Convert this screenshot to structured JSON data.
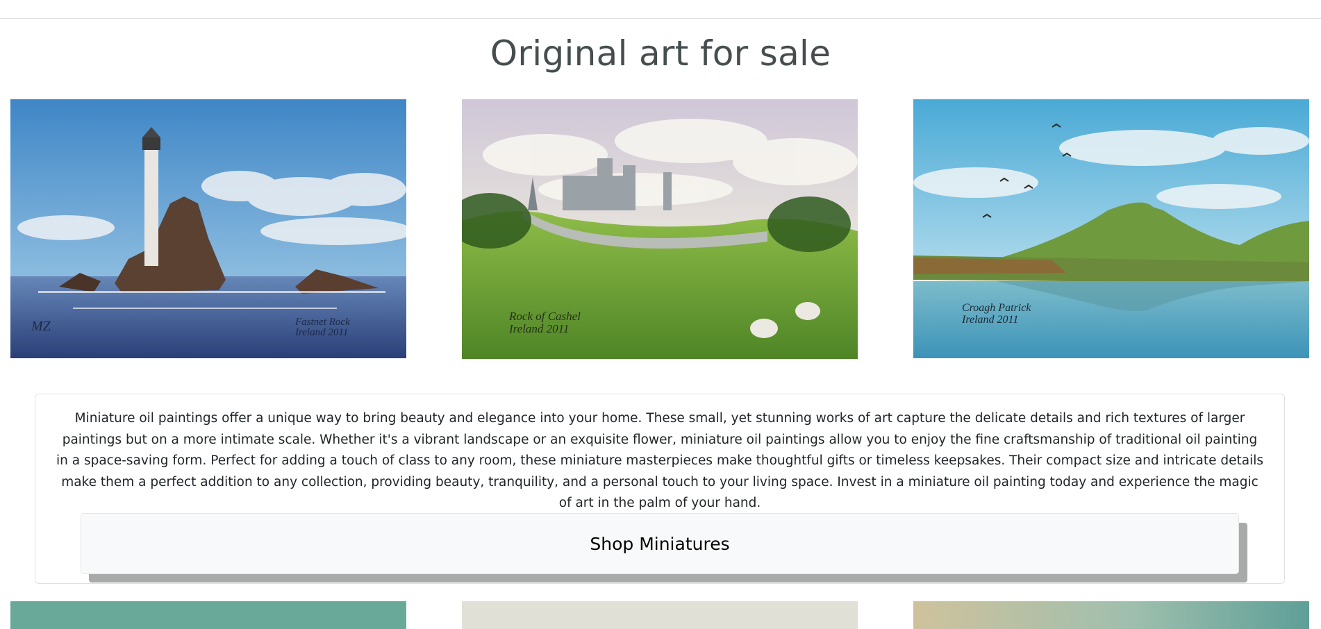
{
  "page": {
    "title": "Original art for sale"
  },
  "gallery": {
    "paintings": [
      {
        "subject": "Fastnet Rock lighthouse",
        "inscription_line1": "Fastnet Rock",
        "inscription_line2": "Ireland 2011",
        "monogram": "MZ",
        "sky": "#4f8fc8",
        "sea": "#2f4f86"
      },
      {
        "subject": "Rock of Cashel",
        "inscription_line1": "Rock of Cashel",
        "inscription_line2": "Ireland 2011",
        "sky": "#d8d5de",
        "grass": "#7cae3a"
      },
      {
        "subject": "Croagh Patrick",
        "inscription_line1": "Croagh Patrick",
        "inscription_line2": "Ireland 2011",
        "sky": "#6db8da",
        "hill": "#6f9a3e"
      }
    ]
  },
  "intro": {
    "text": "Miniature oil paintings offer a unique way to bring beauty and elegance into your home. These small, yet stunning works of art capture the delicate details and rich textures of larger paintings but on a more intimate scale. Whether it's a vibrant landscape or an exquisite flower, miniature oil paintings allow you to enjoy the fine craftsmanship of traditional oil painting in a space-saving form. Perfect for adding a touch of class to any room, these miniature masterpieces make thoughtful gifts or timeless keepsakes. Their compact size and intricate details make them a perfect addition to any collection, providing beauty, tranquility, and a personal touch to your living space. Invest in a miniature oil painting today and experience the magic of art in the palm of your hand.",
    "button_label": "Shop Miniatures"
  }
}
